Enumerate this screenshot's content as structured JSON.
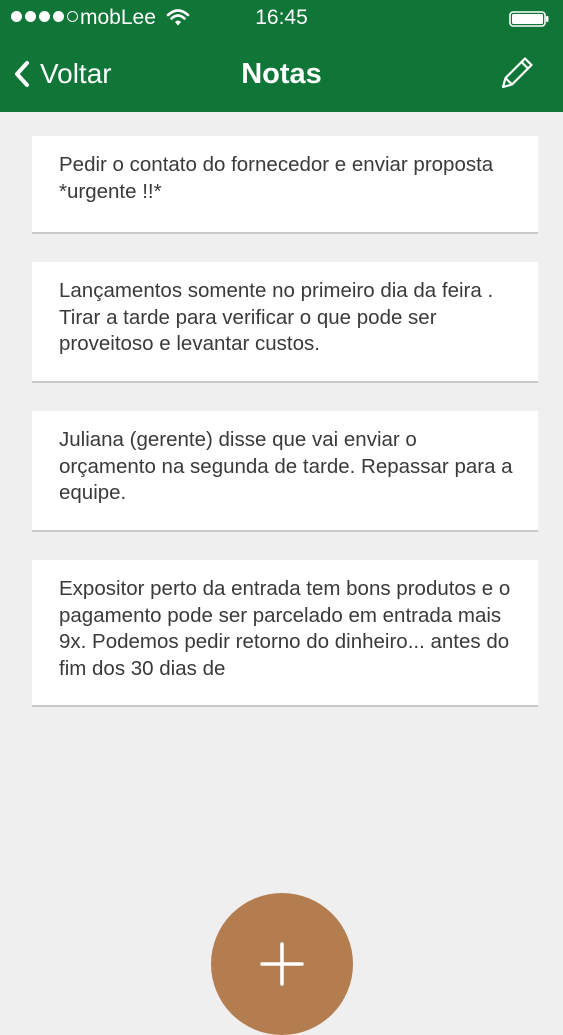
{
  "status_bar": {
    "carrier": "mobLee",
    "time": "16:45"
  },
  "nav": {
    "back_label": "Voltar",
    "title": "Notas"
  },
  "notes": [
    {
      "text": "Pedir o contato do fornecedor e enviar proposta *urgente !!*"
    },
    {
      "text": "Lançamentos somente no primeiro dia da feira . Tirar a tarde para verificar o que pode ser proveitoso e levantar custos."
    },
    {
      "text": "Juliana (gerente) disse que vai enviar o orçamento na segunda de tarde. Repassar para a equipe."
    },
    {
      "text": "Expositor perto da entrada tem bons produtos e o pagamento pode ser parcelado em entrada mais 9x. Podemos pedir retorno do dinheiro... antes do fim dos 30 dias de"
    }
  ],
  "icons": {
    "signal": "signal-dots-icon",
    "wifi": "wifi-icon",
    "battery": "battery-icon",
    "back": "chevron-left-icon",
    "edit": "pencil-icon",
    "add": "plus-icon"
  },
  "colors": {
    "header": "#0f7638",
    "background": "#efefef",
    "fab": "#b37d4f"
  }
}
